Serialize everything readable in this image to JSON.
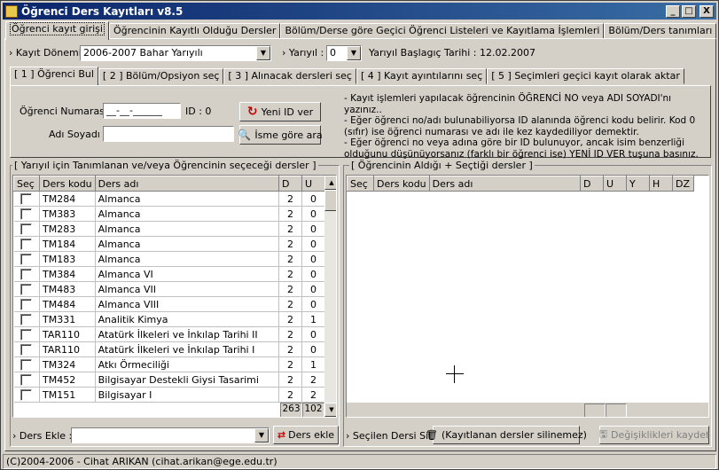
{
  "window": {
    "title": "Öğrenci Ders Kayıtları v8.5",
    "min": "_",
    "max": "□",
    "close": "X"
  },
  "main_tabs": [
    {
      "label": "Öğrenci kayıt girişi"
    },
    {
      "label": "Öğrencinin Kayıtlı Olduğu Dersler"
    },
    {
      "label": "Bölüm/Derse göre Geçici Öğrenci Listeleri ve Kayıtlama İşlemleri"
    },
    {
      "label": "Bölüm/Ders tanımları"
    }
  ],
  "period": {
    "label": "Kayıt Dönemi :",
    "value": "2006-2007 Bahar Yarıyılı",
    "semester_label": "Yarıyıl :",
    "semester_value": "0",
    "start_date_label": "Yarıyıl Başlagıç Tarihi :",
    "start_date": "12.02.2007"
  },
  "step_tabs": [
    {
      "label": "[ 1 ] Öğrenci Bul"
    },
    {
      "label": "[ 2 ] Bölüm/Opsiyon seç"
    },
    {
      "label": "[ 3 ] Alınacak dersleri seç"
    },
    {
      "label": "[ 4 ] Kayıt ayıntılarını seç"
    },
    {
      "label": "[ 5 ] Seçimleri geçici kayıt olarak aktar"
    }
  ],
  "student": {
    "number_label": "Öğrenci Numarası :",
    "number_value": "__-__-______",
    "id_label": "ID : 0",
    "name_label": "Adı Soyadı :",
    "name_value": "",
    "new_id_button": "Yeni ID ver",
    "search_button": "İsme göre ara"
  },
  "help": {
    "line1": "- Kayıt işlemleri yapılacak öğrencinin ÖĞRENCİ NO veya ADI SOYADI'nı yazınız..",
    "line2": "- Eğer öğrenci no/adı bulunabiliyorsa ID alanında öğrenci kodu belirir. Kod 0 (sıfır) ise öğrenci numarası ve adı ile kez kaydediliyor demektir.",
    "line3": "- Eğer öğrenci no veya adına göre bir ID bulunuyor, ancak isim benzerliği olduğunu düşünüyorsanız (farklı bir öğrenci ise) YENİ ID VER tuşuna basınız."
  },
  "left_panel": {
    "title": "[ Yarıyıl için Tanımlanan ve/veya Öğrencinin seçeceği dersler ]",
    "columns": [
      "Seç",
      "Ders kodu",
      "Ders adı",
      "D",
      "U"
    ],
    "rows": [
      {
        "code": "TM284",
        "name": "Almanca",
        "d": "2",
        "u": "0"
      },
      {
        "code": "TM383",
        "name": "Almanca",
        "d": "2",
        "u": "0"
      },
      {
        "code": "TM283",
        "name": "Almanca",
        "d": "2",
        "u": "0"
      },
      {
        "code": "TM184",
        "name": "Almanca",
        "d": "2",
        "u": "0"
      },
      {
        "code": "TM183",
        "name": "Almanca",
        "d": "2",
        "u": "0"
      },
      {
        "code": "TM384",
        "name": "Almanca VI",
        "d": "2",
        "u": "0"
      },
      {
        "code": "TM483",
        "name": "Almanca VII",
        "d": "2",
        "u": "0"
      },
      {
        "code": "TM484",
        "name": "Almanca VIII",
        "d": "2",
        "u": "0"
      },
      {
        "code": "TM331",
        "name": "Analitik Kimya",
        "d": "2",
        "u": "1"
      },
      {
        "code": "TAR110",
        "name": "Atatürk İlkeleri ve İnkılap Tarihi II",
        "d": "2",
        "u": "0"
      },
      {
        "code": "TAR110",
        "name": "Atatürk İlkeleri ve İnkılap Tarihi I",
        "d": "2",
        "u": "0"
      },
      {
        "code": "TM324",
        "name": "Atkı Örmeciliği",
        "d": "2",
        "u": "1"
      },
      {
        "code": "TM452",
        "name": "Bilgisayar Destekli Giysi Tasarimi",
        "d": "2",
        "u": "2"
      },
      {
        "code": "TM151",
        "name": "Bilgisayar I",
        "d": "2",
        "u": "2"
      }
    ],
    "total_d": "263",
    "total_u": "102",
    "add_label": "Ders Ekle :",
    "add_value": "",
    "add_button": "Ders ekle"
  },
  "right_panel": {
    "title": "[ Öğrencinin Aldığı + Seçtiği dersler ]",
    "columns": [
      "Seç",
      "Ders kodu",
      "Ders adı",
      "D",
      "U",
      "Y",
      "H",
      "DZ"
    ],
    "delete_label": "Seçilen Dersi Sil :",
    "delete_button": "(Kayıtlanan dersler silinemez)",
    "save_button": "Değişiklikleri kaydet"
  },
  "status": "(C)2004-2006 - Cihat ARIKAN (cihat.arikan@ege.edu.tr)"
}
